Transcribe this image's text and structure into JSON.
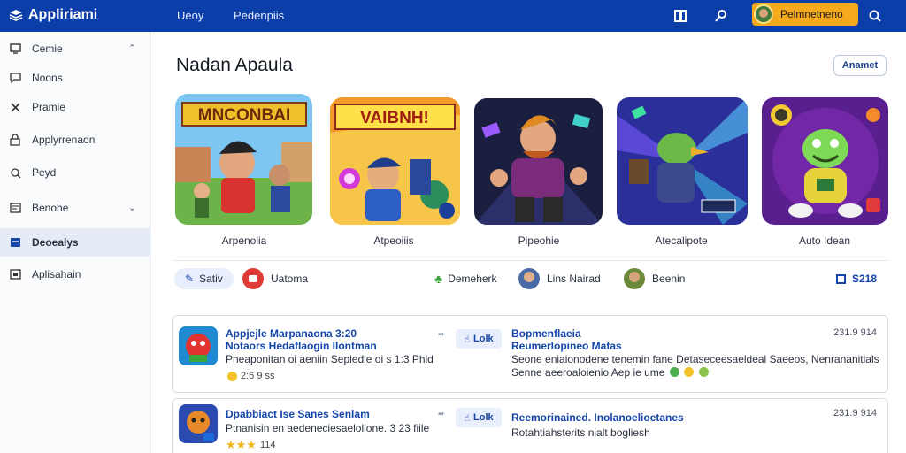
{
  "app": {
    "name": "Appliriami"
  },
  "nav": {
    "link1": "Ueoy",
    "link2": "Pedenpiis"
  },
  "user": {
    "name": "Pelmnetneno"
  },
  "sidebar": {
    "items": [
      {
        "label": "Cemie",
        "icon": "monitor-icon"
      },
      {
        "label": "Noons",
        "icon": "chat-icon"
      },
      {
        "label": "Pramie",
        "icon": "tools-icon"
      },
      {
        "label": "Applyrrenaon",
        "icon": "lock-icon"
      },
      {
        "label": "Peyd",
        "icon": "search-icon"
      },
      {
        "label": "Benohe",
        "icon": "document-icon"
      },
      {
        "label": "Deoealys",
        "icon": "card-icon"
      },
      {
        "label": "Aplisahain",
        "icon": "image-icon"
      }
    ]
  },
  "main": {
    "title": "Nadan Apaula",
    "annotate_label": "Anamet"
  },
  "games": [
    {
      "label": "Arpenolia",
      "banner": "MNCONBAI"
    },
    {
      "label": "Atpeoiiis",
      "banner": "VAIBNH!"
    },
    {
      "label": "Pipeohie",
      "banner": ""
    },
    {
      "label": "Atecalipote",
      "banner": ""
    },
    {
      "label": "Auto Idean",
      "banner": ""
    }
  ],
  "filters": {
    "chip1": "Sativ",
    "chip2": "Uatoma",
    "chip3": "Demeherk",
    "chip4": "Lins Nairad",
    "chip5": "Beenin",
    "chip6": "S218"
  },
  "feed": [
    {
      "title": "Appjejle Marpanaona 3:20",
      "subtitle": "Notaors Hedaflaogin Ilontman",
      "desc": "Pneaponitan oi aeniin Sepiedie oi s 1:3 Phld",
      "rating": "2:6 9 ss",
      "like": "Lolk",
      "rtitle": "Bopmenflaeia",
      "rsub": "Reumerlopineo Matas",
      "rdesc1": "Seone eniaionodene tenemin fane Detaseceesaeldeal Saeeos, Nenrananitials",
      "rdesc2": "Senne aeeroaloienio Aep ie ume",
      "time": "231.9 914"
    },
    {
      "title": "Dpabbiact Ise Sanes Senlam",
      "desc": "Ptnanisin en aedeneciesaelolione. 3 23 fiile",
      "rating": "114",
      "like": "Lolk",
      "rtitle": "Reemorinained. Inolanoelioetanes",
      "rdesc1": "Rotahtiahsterits nialt bogliesh",
      "time": "231.9 914"
    }
  ],
  "colors": {
    "topbar": "#0b3ea8",
    "accent": "#f5a91c",
    "link": "#1446a8"
  }
}
